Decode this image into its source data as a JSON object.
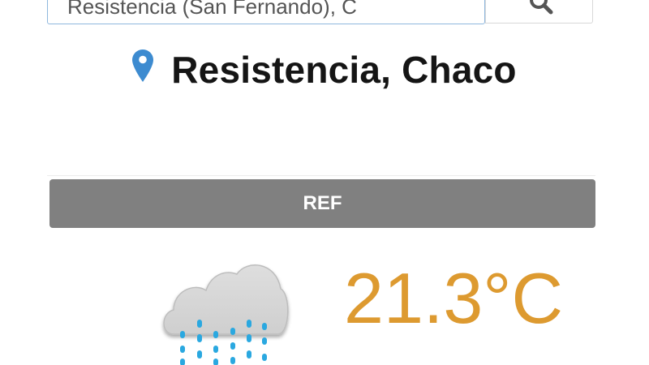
{
  "search": {
    "value": "Resistencia (San Fernando), C",
    "button_icon": "search-icon"
  },
  "location": {
    "icon": "map-pin-icon",
    "title": "Resistencia, Chaco"
  },
  "ref_button": {
    "label": "REF"
  },
  "weather": {
    "icon": "rain-cloud-icon",
    "temperature": "21.3°C"
  },
  "colors": {
    "accent_temperature": "#dd9a30",
    "ref_bar": "#808080",
    "pin": "#3d8bd0",
    "rain": "#2aa8e0"
  }
}
